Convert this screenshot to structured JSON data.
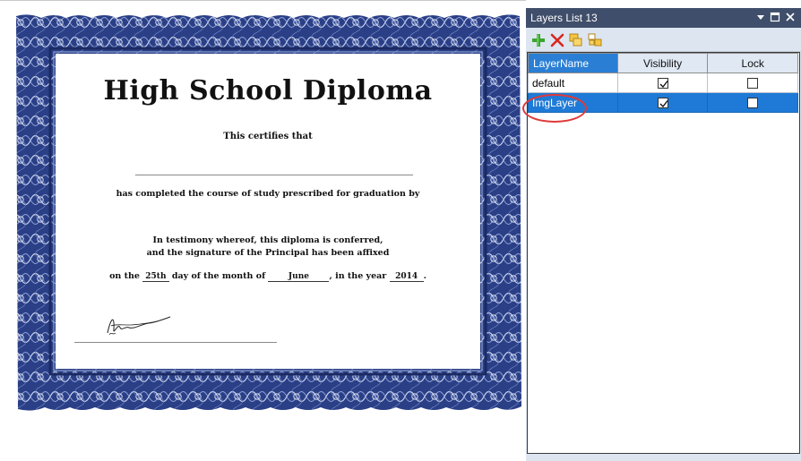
{
  "diploma": {
    "title": "High School Diploma",
    "certifies": "This certifies that",
    "completed": "has completed the course of study prescribed for graduation by",
    "testimony_line1": "In testimony whereof, this diploma is conferred,",
    "testimony_line2": "and the signature of the Principal has been affixed",
    "date_prefix": "on the",
    "day": "25th",
    "date_mid1": "day of the month of",
    "month": "June",
    "date_mid2": ", in the year",
    "year": "2014",
    "date_suffix": ".",
    "frame_color": "#2a3f86"
  },
  "panel": {
    "title": "Layers List 13",
    "header_color": "#3f4e6a",
    "toolbar": {
      "add_icon": "add-layer-icon",
      "delete_icon": "delete-layer-icon",
      "icon3": "merge-layers-icon",
      "icon4": "copy-layers-icon"
    },
    "columns": [
      "LayerName",
      "Visibility",
      "Lock"
    ],
    "rows": [
      {
        "name": "default",
        "visible": true,
        "locked": false,
        "selected": false
      },
      {
        "name": "ImgLayer",
        "visible": true,
        "locked": false,
        "selected": true
      }
    ],
    "selection_color": "#1e7ad6",
    "highlight_color": "#e03a3a"
  }
}
